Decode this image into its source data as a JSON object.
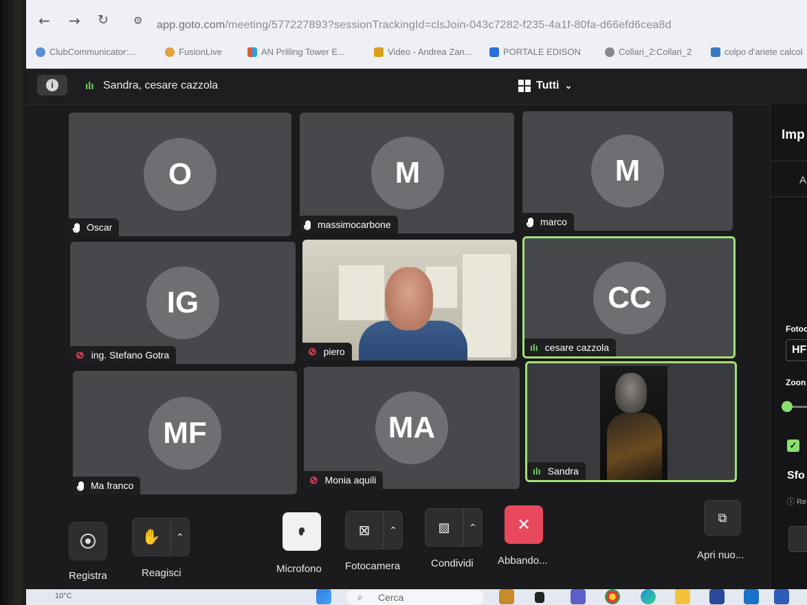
{
  "browser": {
    "url_host": "app.goto.com",
    "url_path": "/meeting/577227893?sessionTrackingId=clsJoin-043c7282-f235-4a1f-80fa-d66efd6cea8d",
    "bookmarks": [
      {
        "label": "ClubCommunicator:...",
        "color": "#5b8dd9"
      },
      {
        "label": "FusionLive",
        "color": "#e0a23b"
      },
      {
        "label": "AN Prilling Tower E...",
        "color": "#e05a2b"
      },
      {
        "label": "Video - Andrea Zan...",
        "color": "#d9a020"
      },
      {
        "label": "PORTALE EDISON",
        "color": "#2b6fd9"
      },
      {
        "label": "Collari_2:Collari_2",
        "color": "#888888"
      },
      {
        "label": "colpo d'ariete calcol",
        "color": "#3a7bbf"
      }
    ]
  },
  "header": {
    "speaking": "Sandra, cesare cazzola",
    "view_label": "Tutti"
  },
  "tiles": [
    {
      "initials": "O",
      "name": "Oscar",
      "mic": "on"
    },
    {
      "initials": "M",
      "name": "massimocarbone",
      "mic": "on"
    },
    {
      "initials": "M",
      "name": "marco",
      "mic": "on"
    },
    {
      "initials": "IG",
      "name": "ing. Stefano Gotra",
      "mic": "muted"
    },
    {
      "initials": "",
      "name": "piero",
      "mic": "muted",
      "video": true
    },
    {
      "initials": "CC",
      "name": "cesare cazzola",
      "mic": "speaking",
      "active": true
    },
    {
      "initials": "MF",
      "name": "Ma franco",
      "mic": "on"
    },
    {
      "initials": "MA",
      "name": "Monia aquili",
      "mic": "muted"
    },
    {
      "initials": "",
      "name": "Sandra",
      "mic": "speaking",
      "video": true,
      "active": true
    }
  ],
  "side_panel": {
    "title": "Imp",
    "tab": "A",
    "camera_label": "Fotoc",
    "camera_value": "HF",
    "zoom_label": "Zoon",
    "blur_label": "Sfo",
    "note": "ⓘ Re"
  },
  "toolbar": {
    "record": "Registra",
    "react": "Reagisci",
    "mic": "Microfono",
    "camera": "Fotocamera",
    "share": "Condividi",
    "leave": "Abbando...",
    "open_new": "Apri nuo..."
  },
  "taskbar": {
    "weather": "10°C",
    "search": "Cerca"
  },
  "colors": {
    "active_border": "#a4e27a",
    "speaking": "#6ed45a",
    "muted": "#e5485d",
    "leave": "#e8495d"
  }
}
